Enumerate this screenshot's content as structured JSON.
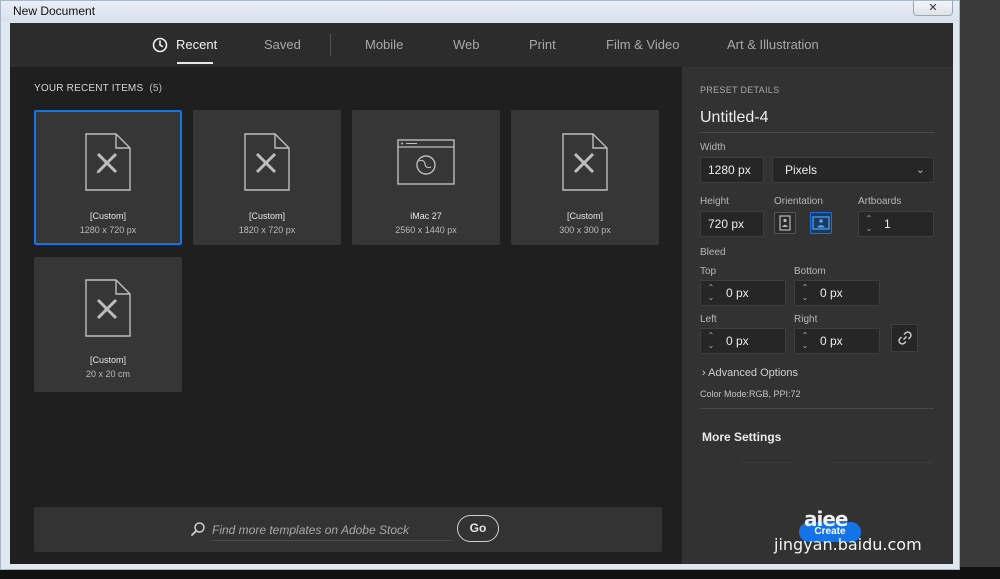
{
  "window": {
    "title": "New Document",
    "close_glyph": "✕"
  },
  "tabs": [
    {
      "label": "Recent",
      "active": true
    },
    {
      "label": "Saved"
    },
    {
      "label": "Mobile"
    },
    {
      "label": "Web"
    },
    {
      "label": "Print"
    },
    {
      "label": "Film & Video"
    },
    {
      "label": "Art & Illustration"
    }
  ],
  "recent": {
    "header": "YOUR RECENT ITEMS",
    "count": "(5)",
    "items": [
      {
        "name": "[Custom]",
        "size": "1280 x 720 px",
        "icon": "custom-document-icon",
        "selected": true
      },
      {
        "name": "[Custom]",
        "size": "1820 x 720 px",
        "icon": "custom-document-icon"
      },
      {
        "name": "iMac 27",
        "size": "2560 x 1440 px",
        "icon": "web-browser-icon"
      },
      {
        "name": "[Custom]",
        "size": "300 x 300 px",
        "icon": "custom-document-icon"
      },
      {
        "name": "[Custom]",
        "size": "20 x 20 cm",
        "icon": "custom-document-icon"
      }
    ]
  },
  "stock": {
    "placeholder": "Find more templates on Adobe Stock",
    "go_label": "Go"
  },
  "preset": {
    "header": "PRESET DETAILS",
    "doc_name": "Untitled-4",
    "width_label": "Width",
    "width_value": "1280 px",
    "units_value": "Pixels",
    "height_label": "Height",
    "height_value": "720 px",
    "orientation_label": "Orientation",
    "artboards_label": "Artboards",
    "artboards_value": "1",
    "bleed_label": "Bleed",
    "top_label": "Top",
    "top_value": "0 px",
    "bottom_label": "Bottom",
    "bottom_value": "0 px",
    "left_label": "Left",
    "left_value": "0 px",
    "right_label": "Right",
    "right_value": "0 px",
    "advanced_label": "Advanced Options",
    "color_mode": "Color Mode:RGB, PPI:72",
    "more_settings": "More Settings",
    "create_label": "Create"
  },
  "watermark": {
    "logo": "aiee",
    "text": "jingyan.baidu.com"
  },
  "colors": {
    "accent": "#1473e6",
    "panel": "#323232",
    "background": "#1f1f1f"
  }
}
